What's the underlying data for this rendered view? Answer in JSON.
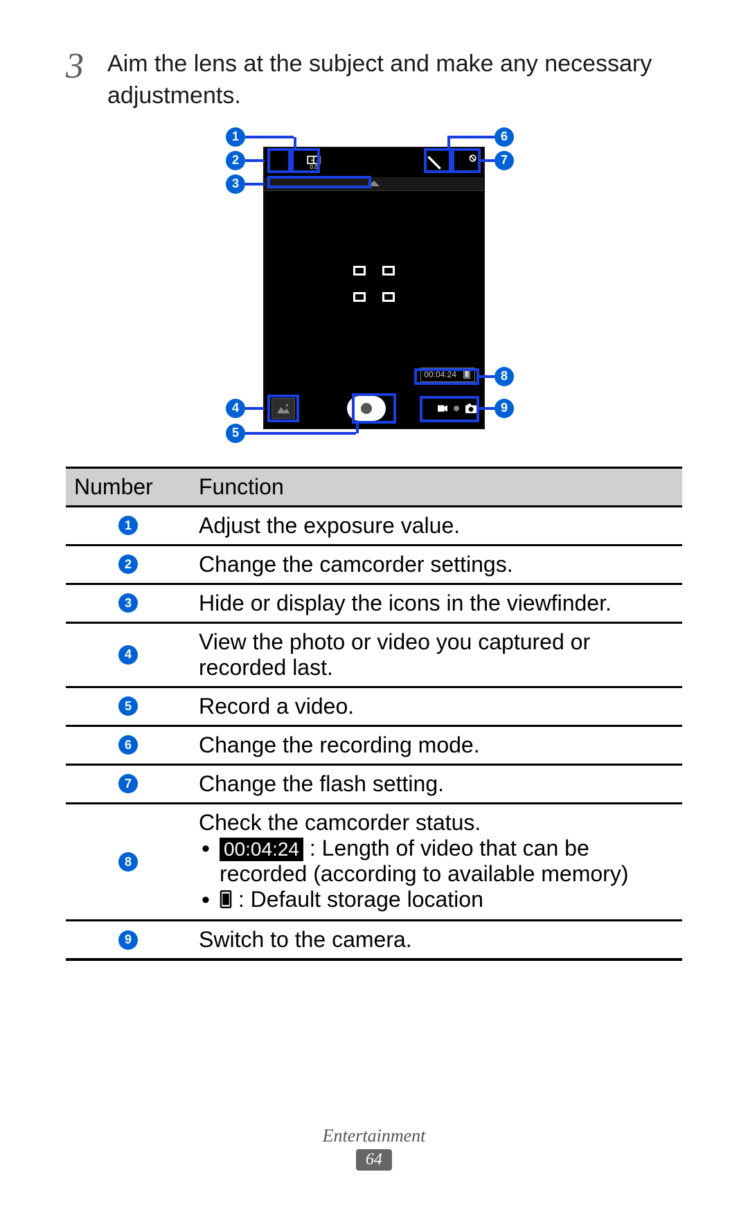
{
  "step": {
    "number": "3",
    "text": "Aim the lens at the subject and make any necessary adjustments."
  },
  "callouts": {
    "c1": "1",
    "c2": "2",
    "c3": "3",
    "c4": "4",
    "c5": "5",
    "c6": "6",
    "c7": "7",
    "c8": "8",
    "c9": "9"
  },
  "screen": {
    "exposure_value": "0.0",
    "record_time": "00:04:24"
  },
  "table": {
    "header_number": "Number",
    "header_function": "Function",
    "rows": {
      "r1": {
        "num": "1",
        "func": "Adjust the exposure value."
      },
      "r2": {
        "num": "2",
        "func": "Change the camcorder settings."
      },
      "r3": {
        "num": "3",
        "func": "Hide or display the icons in the viewfinder."
      },
      "r4": {
        "num": "4",
        "func": "View the photo or video you captured or recorded last."
      },
      "r5": {
        "num": "5",
        "func": "Record a video."
      },
      "r6": {
        "num": "6",
        "func": "Change the recording mode."
      },
      "r7": {
        "num": "7",
        "func": "Change the flash setting."
      },
      "r8": {
        "num": "8",
        "heading": "Check the camcorder status.",
        "time_chip": "00:04:24",
        "bullet1_rest": " : Length of video that can be recorded (according to available memory)",
        "bullet2": " : Default storage location"
      },
      "r9": {
        "num": "9",
        "func": "Switch to the camera."
      }
    }
  },
  "footer": {
    "section": "Entertainment",
    "page": "64"
  }
}
